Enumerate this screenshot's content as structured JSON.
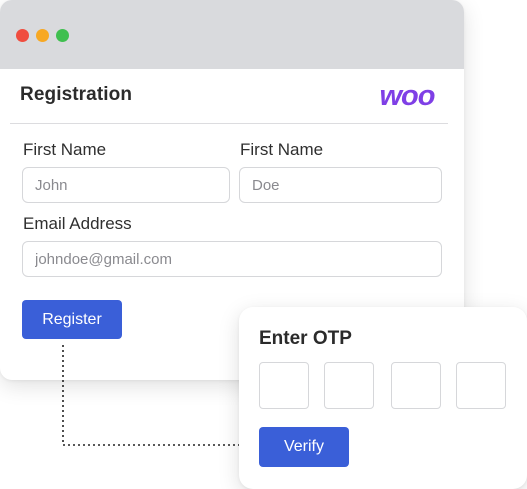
{
  "colors": {
    "titlebar": "#d9dadd",
    "accent": "#3a5fd8",
    "brand": "#7f3fe6",
    "traffic_red": "#f04d3f",
    "traffic_yellow": "#f7a823",
    "traffic_green": "#3fbf4f"
  },
  "window": {
    "title": "Registration",
    "logo_text": "woo"
  },
  "form": {
    "first_name_label": "First Name",
    "first_name_placeholder": "John",
    "last_name_label": "First Name",
    "last_name_placeholder": "Doe",
    "email_label": "Email Address",
    "email_placeholder": "johndoe@gmail.com",
    "register_label": "Register"
  },
  "otp": {
    "title": "Enter OTP",
    "digits": [
      "",
      "",
      "",
      ""
    ],
    "verify_label": "Verify"
  }
}
